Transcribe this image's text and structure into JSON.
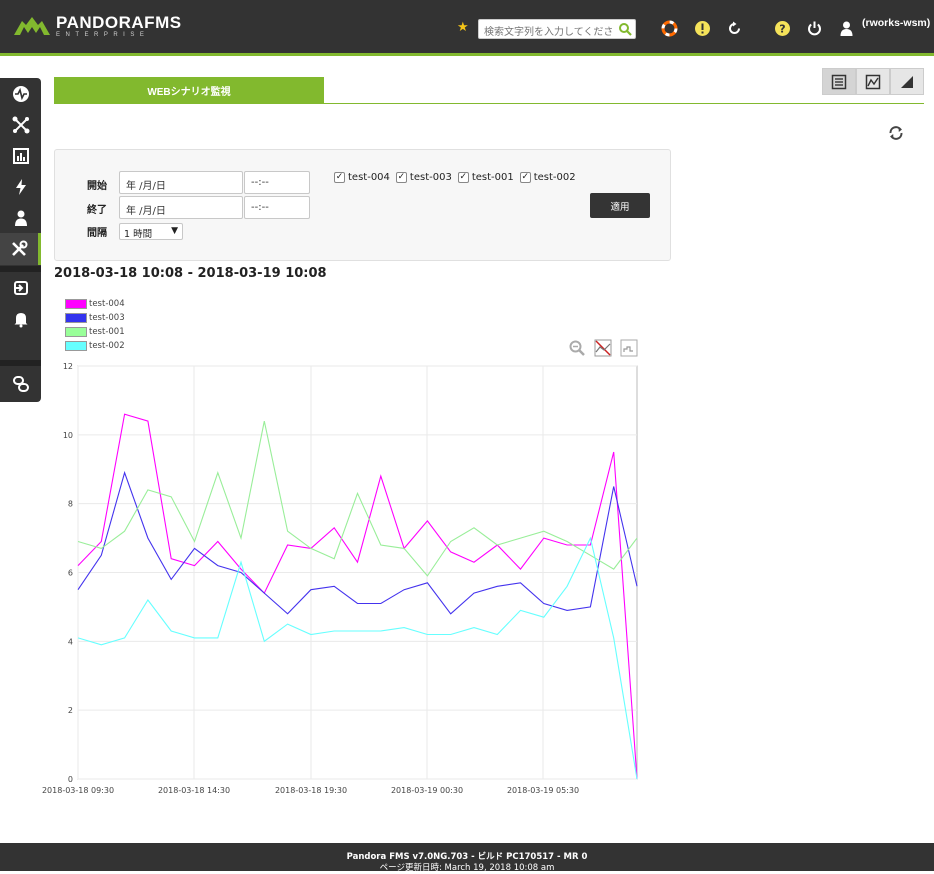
{
  "header": {
    "logo_main": "PANDORAFMS",
    "logo_sub": "ENTERPRISE",
    "search_placeholder": "検索文字列を入力してくださ",
    "user": "(rworks-wsm)"
  },
  "tabs": {
    "active_label": "WEBシナリオ監視"
  },
  "filter": {
    "start_label": "開始",
    "end_label": "終了",
    "interval_label": "間隔",
    "start_date": "年 /月/日",
    "start_time": "--:--",
    "end_date": "年 /月/日",
    "end_time": "--:--",
    "interval_value": "1 時間",
    "checkboxes": [
      {
        "label": "test-004",
        "checked": true
      },
      {
        "label": "test-003",
        "checked": true
      },
      {
        "label": "test-001",
        "checked": true
      },
      {
        "label": "test-002",
        "checked": true
      }
    ],
    "apply_label": "適用"
  },
  "range_title": "2018-03-18 10:08 - 2018-03-19 10:08",
  "footer": {
    "version": "Pandora FMS v7.0NG.703 - ビルド PC170517 - MR 0",
    "updated": "ページ更新日時: March 19, 2018 10:08 am"
  },
  "chart_data": {
    "type": "line",
    "ylim": [
      0,
      12
    ],
    "y_ticks": [
      0,
      2,
      4,
      6,
      8,
      10,
      12
    ],
    "x_tick_labels": [
      "2018-03-18 09:30",
      "2018-03-18 14:30",
      "2018-03-18 19:30",
      "2018-03-19 00:30",
      "2018-03-19 05:30"
    ],
    "x_points": 24,
    "grid": true,
    "legend_position": "top-left",
    "series": [
      {
        "name": "test-004",
        "color": "#ff00ff",
        "values": [
          6.2,
          6.9,
          10.6,
          10.4,
          6.4,
          6.2,
          6.9,
          6.1,
          5.4,
          6.8,
          6.7,
          7.3,
          6.3,
          8.8,
          6.7,
          7.5,
          6.6,
          6.3,
          6.8,
          6.1,
          7.0,
          6.8,
          6.8,
          9.5,
          0.0
        ]
      },
      {
        "name": "test-003",
        "color": "#4433ee",
        "values": [
          5.5,
          6.5,
          8.9,
          7.0,
          5.8,
          6.7,
          6.2,
          6.0,
          5.4,
          4.8,
          5.5,
          5.6,
          5.1,
          5.1,
          5.5,
          5.7,
          4.8,
          5.4,
          5.6,
          5.7,
          5.1,
          4.9,
          5.0,
          8.5,
          5.6
        ]
      },
      {
        "name": "test-001",
        "color": "#99ee99",
        "values": [
          6.9,
          6.7,
          7.2,
          8.4,
          8.2,
          6.9,
          8.9,
          7.0,
          10.4,
          7.2,
          6.7,
          6.4,
          8.3,
          6.8,
          6.7,
          5.9,
          6.9,
          7.3,
          6.8,
          7.0,
          7.2,
          6.9,
          6.5,
          6.1,
          7.0
        ]
      },
      {
        "name": "test-002",
        "color": "#66ffff",
        "values": [
          4.1,
          3.9,
          4.1,
          5.2,
          4.3,
          4.1,
          4.1,
          6.3,
          4.0,
          4.5,
          4.2,
          4.3,
          4.3,
          4.3,
          4.4,
          4.2,
          4.2,
          4.4,
          4.2,
          4.9,
          4.7,
          5.6,
          7.0,
          4.1,
          0.0
        ]
      }
    ]
  }
}
